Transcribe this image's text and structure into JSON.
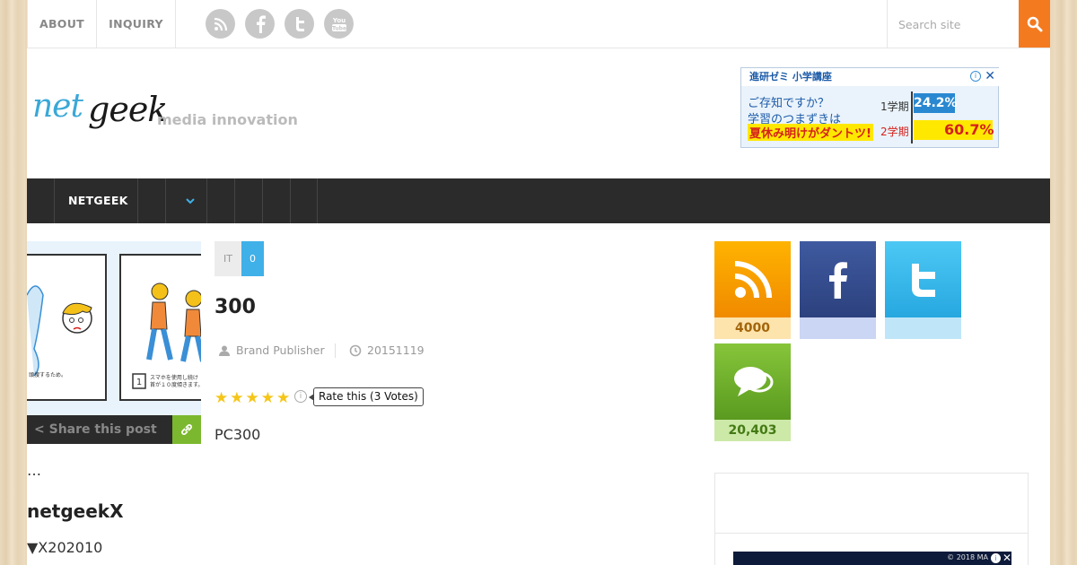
{
  "topbar": {
    "about": "ABOUT",
    "inquiry": "INQUIRY",
    "search_placeholder": "Search site",
    "social_icons": [
      "rss-icon",
      "facebook-icon",
      "twitter-icon",
      "youtube-icon"
    ]
  },
  "header": {
    "logo_part1": "net",
    "logo_part2": "geek",
    "tagline": "media innovation"
  },
  "ad_top": {
    "title": "進研ゼミ 小学講座",
    "line1": "ご存知ですか？",
    "line2": "学習のつまずきは",
    "line3": "夏休み明けがダントツ!",
    "term1": "1学期",
    "term2": "2学期",
    "val1": "24.2%",
    "val2": "60.7%"
  },
  "nav": {
    "label": "NETGEEK"
  },
  "post": {
    "category": "IT",
    "comment_count": "0",
    "title": "300",
    "author": "Brand Publisher",
    "date": "20151119",
    "rate_label": "Rate this (3 Votes)",
    "rating_stars": 5,
    "excerpt": "PC300",
    "share_label": "Share this post"
  },
  "body": {
    "ellipsis": "…",
    "section_heading": "netgeekX",
    "section_sub": "▼X202010"
  },
  "thumb": {
    "caption_left": "頭捜するため。",
    "caption_step": "1",
    "caption_right1": "スマホを使用し続け",
    "caption_right2": "首が１０度傾きます。"
  },
  "counters": {
    "rss": "4000",
    "facebook": "",
    "twitter": "",
    "comments": "20,403"
  },
  "ad_bottom": {
    "copy": "© 2018 MA"
  },
  "colors": {
    "accent_orange": "#f47a20",
    "nav_bg": "#2b2b2b",
    "category_blue": "#3fb0e8",
    "share_green": "#7cb82f",
    "star_yellow": "#f5c518"
  }
}
